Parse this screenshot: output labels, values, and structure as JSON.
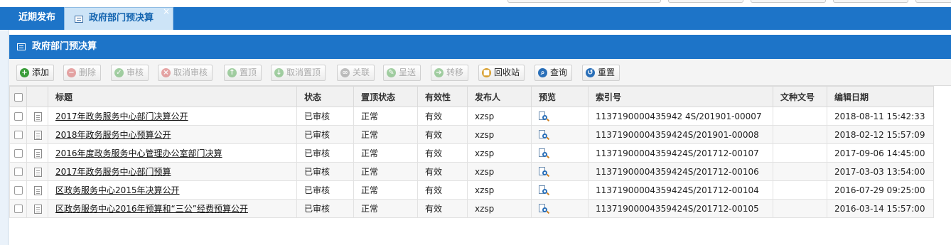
{
  "tabs": {
    "recent_label": "近期发布",
    "active_label": "政府部门预决算",
    "close_glyph": "×"
  },
  "panel": {
    "title": "政府部门预决算"
  },
  "toolbar": [
    {
      "label": "添加",
      "enabled": true,
      "icon": "plus-icon",
      "color": "#3a9d3a"
    },
    {
      "label": "删除",
      "enabled": false,
      "icon": "minus-icon",
      "color": "#d04040"
    },
    {
      "label": "审核",
      "enabled": false,
      "icon": "check-icon",
      "color": "#3a9d3a"
    },
    {
      "label": "取消审核",
      "enabled": false,
      "icon": "cancel-icon",
      "color": "#d04040"
    },
    {
      "label": "置顶",
      "enabled": false,
      "icon": "arrow-up-icon",
      "color": "#3a9d3a"
    },
    {
      "label": "取消置顶",
      "enabled": false,
      "icon": "arrow-down-icon",
      "color": "#3a9d3a"
    },
    {
      "label": "关联",
      "enabled": false,
      "icon": "link-icon",
      "color": "#777777"
    },
    {
      "label": "呈送",
      "enabled": false,
      "icon": "send-icon",
      "color": "#3a9d3a"
    },
    {
      "label": "转移",
      "enabled": false,
      "icon": "move-icon",
      "color": "#3a9d3a"
    },
    {
      "label": "回收站",
      "enabled": true,
      "icon": "recycle-box-icon",
      "color": "#d8a030"
    },
    {
      "label": "查询",
      "enabled": true,
      "icon": "search-icon",
      "color": "#2a6fb8"
    },
    {
      "label": "重置",
      "enabled": true,
      "icon": "reset-icon",
      "color": "#2a6fb8"
    }
  ],
  "columns": [
    "标题",
    "状态",
    "置顶状态",
    "有效性",
    "发布人",
    "预览",
    "索引号",
    "文种文号",
    "编辑日期"
  ],
  "rows": [
    {
      "title": "2017年政务服务中心部门决算公开",
      "status": "已审核",
      "top": "正常",
      "valid": "有效",
      "publisher": "xzsp",
      "index": "1137190000435942 4S/201901-00007",
      "docno": "",
      "date": "2018-08-11 15:42:33"
    },
    {
      "title": "2018年政务服务中心预算公开",
      "status": "已审核",
      "top": "正常",
      "valid": "有效",
      "publisher": "xzsp",
      "index": "11371900004359424S/201901-00008",
      "docno": "",
      "date": "2018-02-12 15:57:09"
    },
    {
      "title": "2016年度政务服务中心管理办公室部门决算",
      "status": "已审核",
      "top": "正常",
      "valid": "有效",
      "publisher": "xzsp",
      "index": "11371900004359424S/201712-00107",
      "docno": "",
      "date": "2017-09-06 14:45:00"
    },
    {
      "title": "2017年政务服务中心部门预算",
      "status": "已审核",
      "top": "正常",
      "valid": "有效",
      "publisher": "xzsp",
      "index": "11371900004359424S/201712-00106",
      "docno": "",
      "date": "2017-03-03 13:54:00"
    },
    {
      "title": "区政务服务中心2015年决算公开",
      "status": "已审核",
      "top": "正常",
      "valid": "有效",
      "publisher": "xzsp",
      "index": "11371900004359424S/201712-00104",
      "docno": "",
      "date": "2016-07-29 09:25:00"
    },
    {
      "title": "区政务服务中心2016年预算和“三公”经费预算公开",
      "status": "已审核",
      "top": "正常",
      "valid": "有效",
      "publisher": "xzsp",
      "index": "11371900004359424S/201712-00105",
      "docno": "",
      "date": "2016-03-14 15:57:00"
    }
  ]
}
